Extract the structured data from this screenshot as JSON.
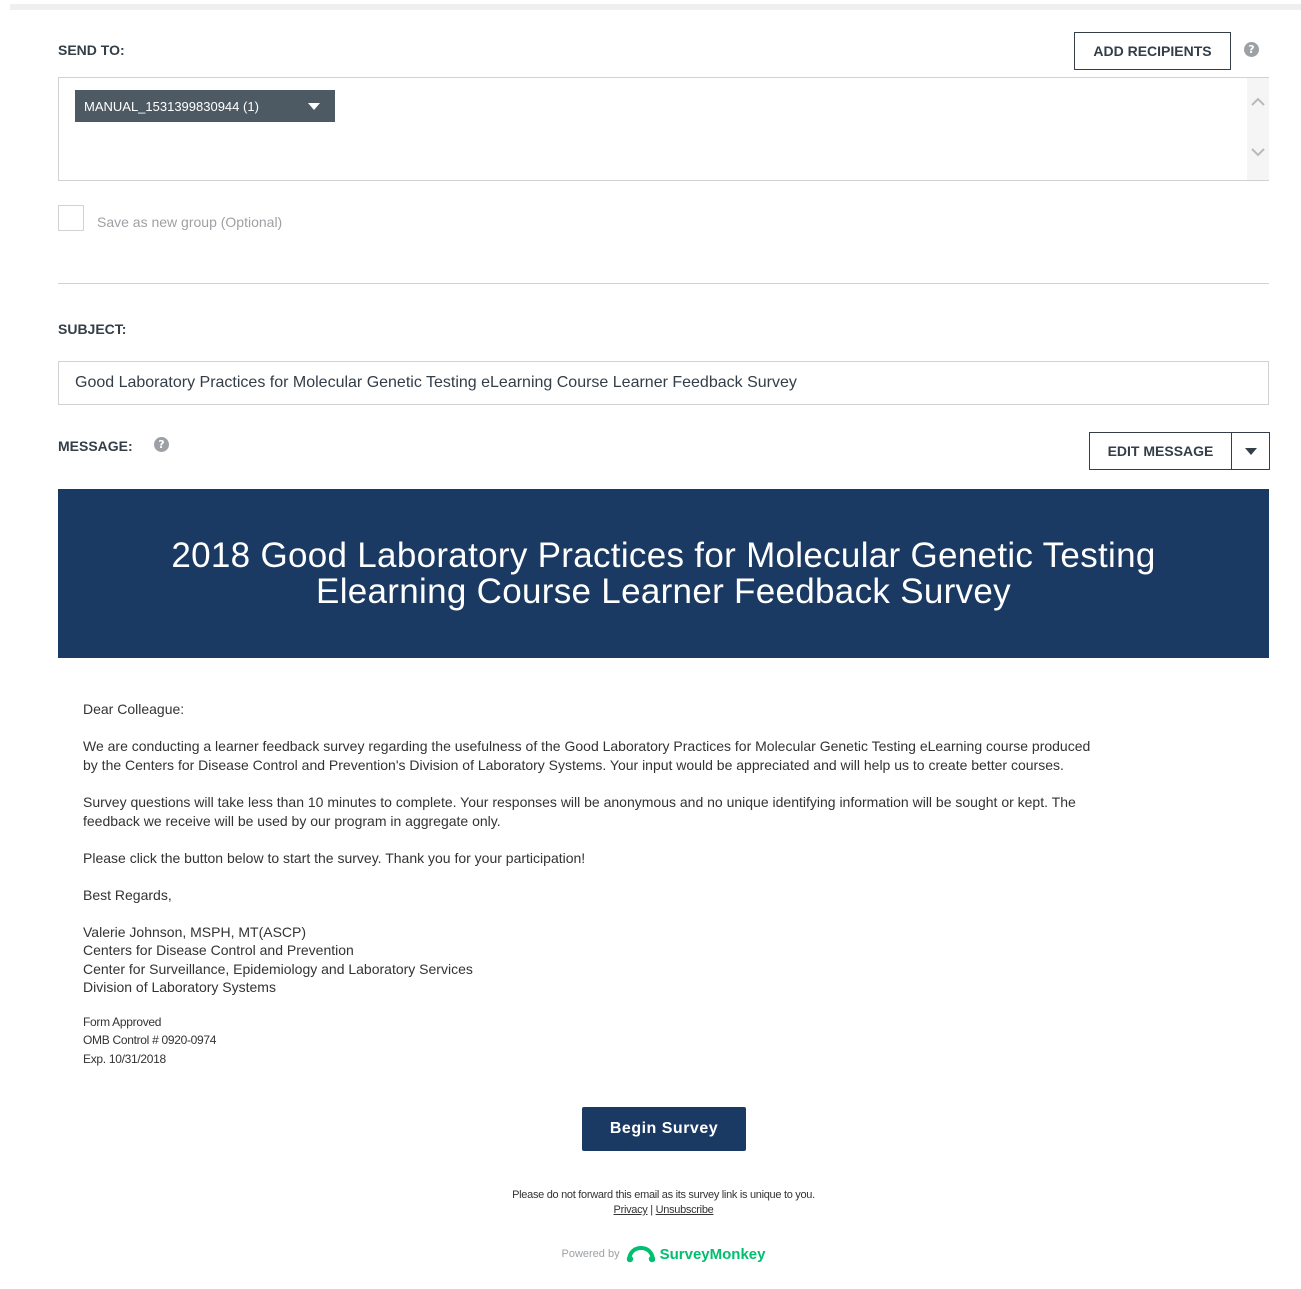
{
  "send_to": {
    "label": "SEND TO:",
    "add_recipients_label": "ADD RECIPIENTS",
    "help_glyph": "?",
    "recipient_chip": "MANUAL_1531399830944 (1)",
    "save_group_label": "Save as new group (Optional)"
  },
  "subject": {
    "label": "SUBJECT:",
    "value": "Good Laboratory Practices for Molecular Genetic Testing eLearning Course Learner Feedback Survey"
  },
  "message": {
    "label": "MESSAGE:",
    "edit_label": "EDIT MESSAGE"
  },
  "email": {
    "banner_line1": "2018 Good Laboratory Practices for Molecular Genetic Testing",
    "banner_line2": "Elearning Course Learner Feedback Survey",
    "greeting": "Dear Colleague:",
    "para1_line1": "We are conducting a learner feedback survey regarding the usefulness of the Good Laboratory Practices for Molecular Genetic Testing eLearning course produced",
    "para1_line2": "by the Centers for Disease Control and Prevention's Division of Laboratory Systems. Your input would be appreciated and will help us to create better courses.",
    "para2_line1": "Survey questions will take less than 10 minutes to complete.  Your responses will be anonymous and no unique identifying information will be sought or kept. The",
    "para2_line2": "feedback we receive will be used by our program in aggregate only.",
    "para3": "Please click the button below to start the survey. Thank you for your participation!",
    "closing": "Best Regards,",
    "sig1": "Valerie Johnson, MSPH, MT(ASCP)",
    "sig2": "Centers for Disease Control and Prevention",
    "sig3": "Center for Surveillance, Epidemiology and Laboratory Services",
    "sig4": "Division of Laboratory Systems",
    "form1": "Form Approved",
    "form2": "OMB Control # 0920-0974",
    "form3": "Exp. 10/31/2018",
    "begin_button": "Begin Survey",
    "footer_note": "Please do not forward this email as its survey link is unique to you.",
    "privacy_link": "Privacy",
    "link_separator": "|",
    "unsubscribe_link": "Unsubscribe",
    "powered_by": "Powered by",
    "brand": "SurveyMonkey"
  },
  "colors": {
    "banner": "#1b3a63",
    "brand_green": "#00bf6f",
    "chip": "#4d5963"
  },
  "icons": {
    "help": "help-icon",
    "chip_caret": "caret-down-icon",
    "scroll_up": "chevron-up-icon",
    "scroll_down": "chevron-down-icon",
    "edit_dropdown": "caret-down-icon",
    "brand_logo": "surveymonkey-logo-icon"
  }
}
